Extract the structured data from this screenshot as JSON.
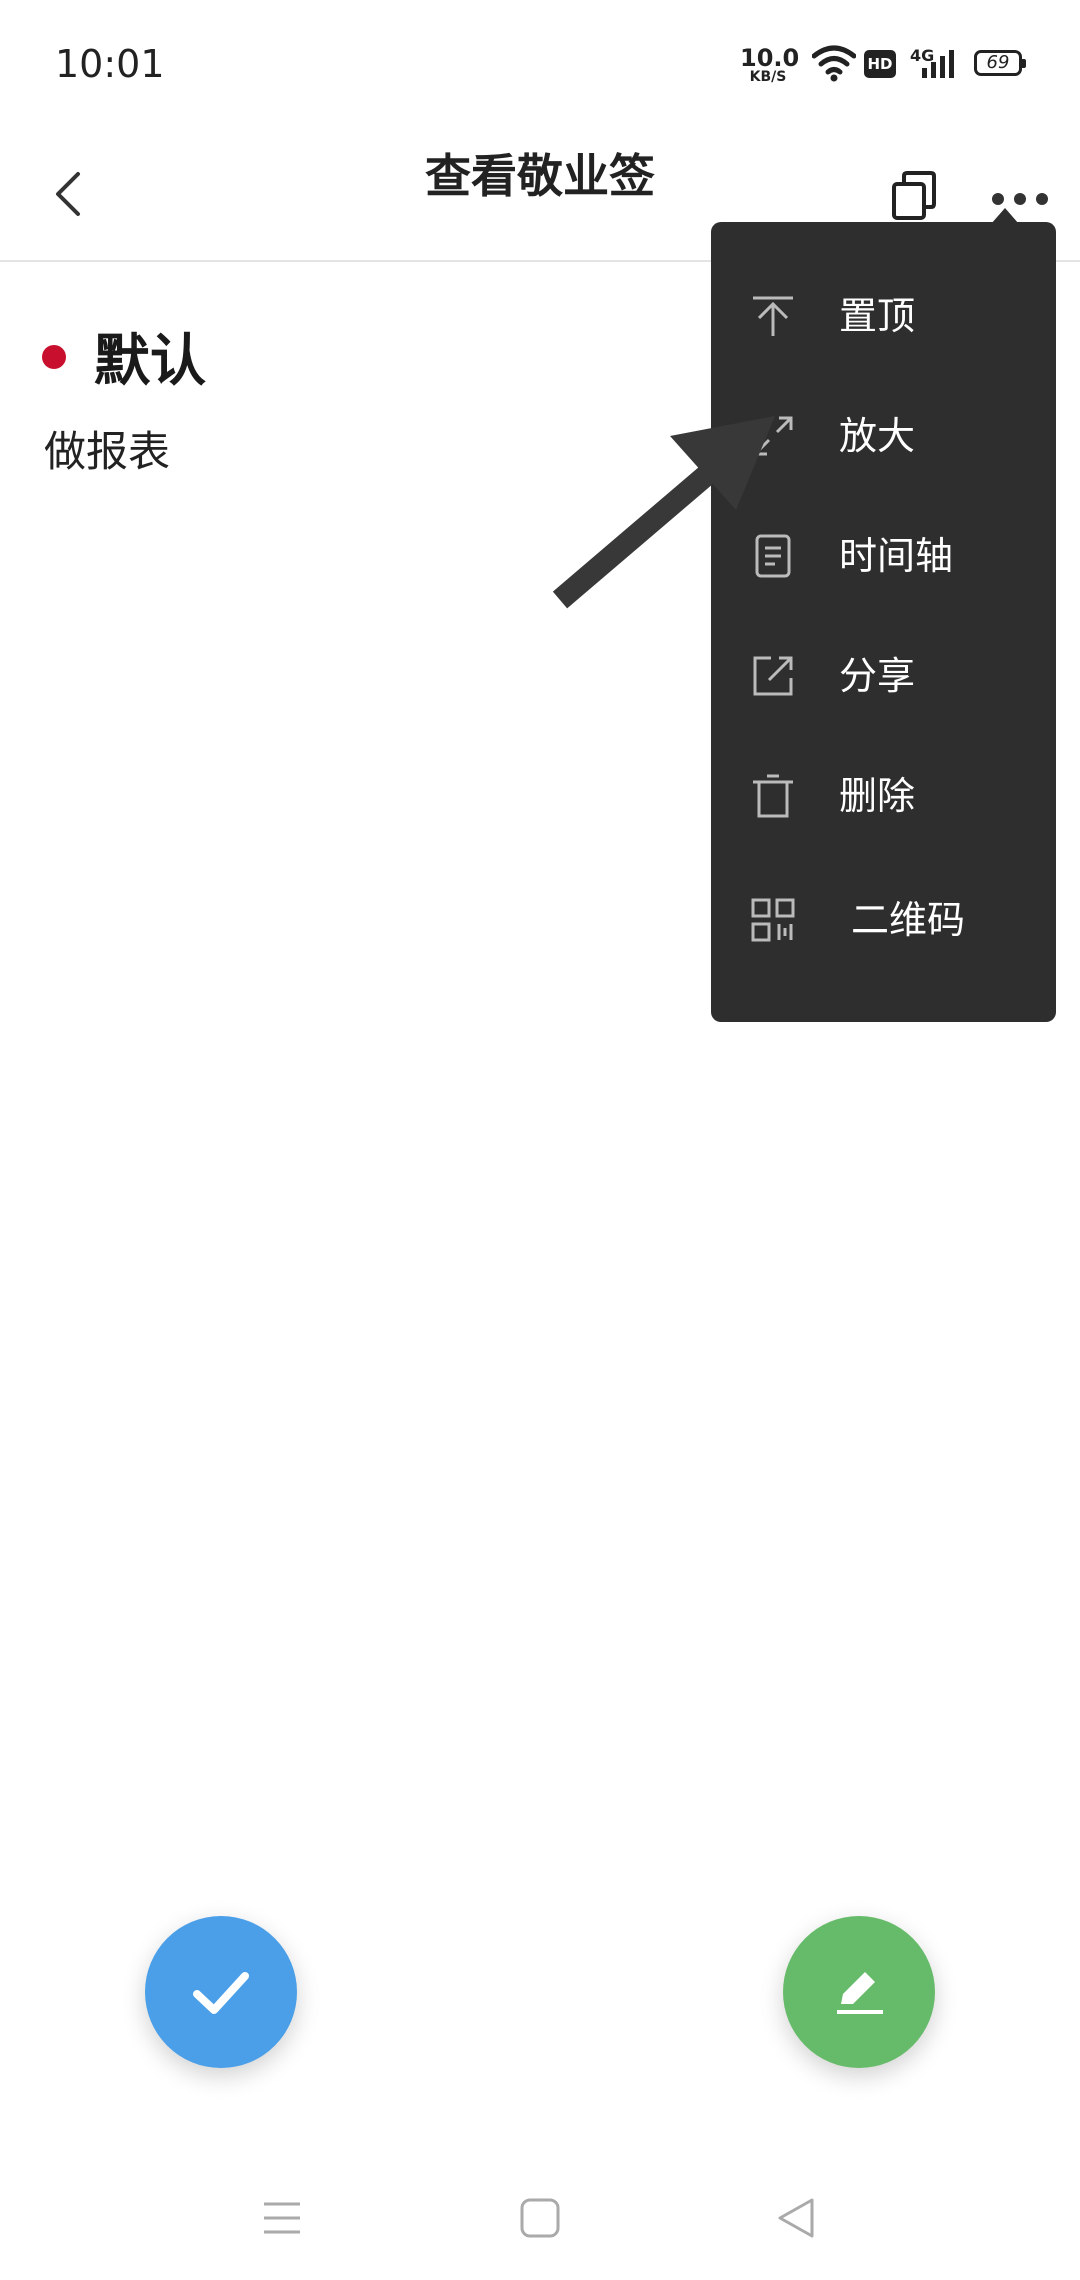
{
  "status_bar": {
    "time": "10:01",
    "net_speed_value": "10.0",
    "net_speed_unit": "KB/S",
    "hd_badge": "HD",
    "network_type": "4G",
    "battery": "69",
    "icons": [
      "wifi-icon",
      "hd-icon",
      "signal-icon",
      "battery-icon"
    ]
  },
  "header": {
    "title": "查看敬业签",
    "back_icon": "back-icon",
    "copy_icon": "copy-icon",
    "more_icon": "more-icon"
  },
  "note": {
    "category": "默认",
    "category_color": "#c8102e",
    "content": "做报表"
  },
  "menu": {
    "items": [
      {
        "label": "置顶",
        "icon": "pin-top-icon"
      },
      {
        "label": "放大",
        "icon": "expand-icon"
      },
      {
        "label": "时间轴",
        "icon": "timeline-icon"
      },
      {
        "label": "分享",
        "icon": "share-icon"
      },
      {
        "label": "删除",
        "icon": "trash-icon"
      },
      {
        "label": "二维码",
        "icon": "qrcode-icon"
      }
    ]
  },
  "fabs": {
    "complete": {
      "icon": "check-icon",
      "color": "#4a9fe8"
    },
    "edit": {
      "icon": "edit-icon",
      "color": "#66bb6a"
    }
  },
  "nav_bar": {
    "icons": [
      "menu-icon",
      "home-icon",
      "back-triangle-icon"
    ]
  }
}
